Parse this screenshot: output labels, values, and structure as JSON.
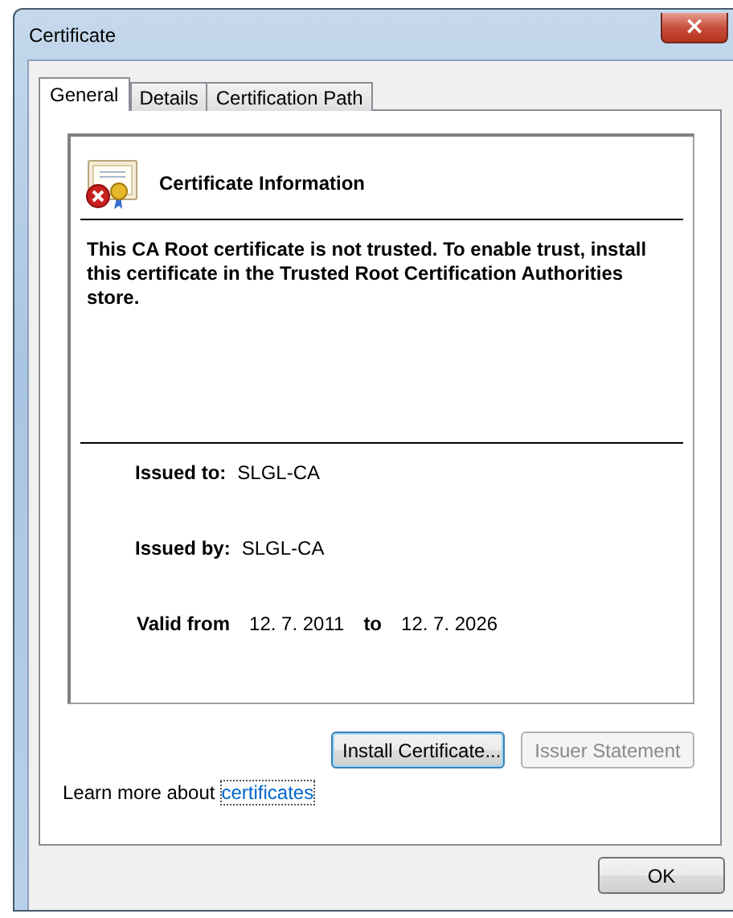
{
  "window": {
    "title": "Certificate",
    "close": "×"
  },
  "tabs": [
    {
      "label": "General",
      "selected": true
    },
    {
      "label": "Details",
      "selected": false
    },
    {
      "label": "Certification Path",
      "selected": false
    }
  ],
  "info": {
    "title": "Certificate Information",
    "message": "This CA Root certificate is not trusted. To enable trust, install this certificate in the Trusted Root Certification Authorities store."
  },
  "fields": [
    {
      "label": "Issued to:",
      "value": "SLGL-CA"
    },
    {
      "label": "Issued by:",
      "value": "SLGL-CA"
    }
  ],
  "validity": {
    "label": "Valid from",
    "from": "12. 7. 2011",
    "joiner": "to",
    "to": "12. 7. 2026"
  },
  "buttons": [
    {
      "label": "Install Certificate...",
      "disabled": false,
      "focused": true
    },
    {
      "label": "Issuer Statement",
      "disabled": true,
      "focused": false
    }
  ],
  "learn_more": {
    "text": "Learn more about",
    "link": "certificates"
  },
  "ok": "OK"
}
